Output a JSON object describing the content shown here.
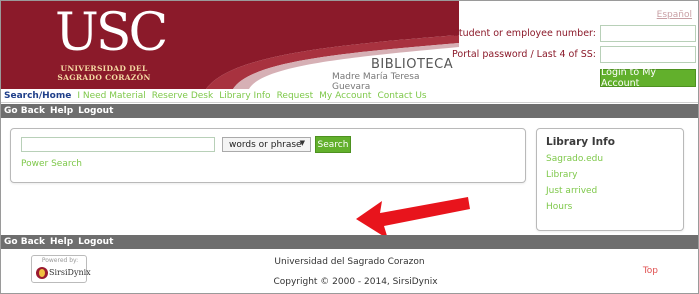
{
  "colors": {
    "brand": "#8b1a2a",
    "accent_green": "#62b02c",
    "link_green": "#7ec84a",
    "bar_grey": "#6e6e6e",
    "arrow_red": "#e8141c"
  },
  "header": {
    "logo": {
      "letters": "USC",
      "line1": "UNIVERSIDAD DEL",
      "line2": "SAGRADO CORAZÓN"
    },
    "library_title": "BIBLIOTECA",
    "library_subtitle": "Madre María Teresa Guevara"
  },
  "login": {
    "language_link": "Español",
    "user_label": "Student or employee number:",
    "user_value": "",
    "password_label": "Portal password / Last 4 of SS:",
    "password_value": "",
    "login_button": "Login to My Account"
  },
  "nav": {
    "items": [
      {
        "label": "Search/Home",
        "active": true
      },
      {
        "label": "I Need Material",
        "active": false
      },
      {
        "label": "Reserve Desk",
        "active": false
      },
      {
        "label": "Library Info",
        "active": false
      },
      {
        "label": "Request",
        "active": false
      },
      {
        "label": "My Account",
        "active": false
      },
      {
        "label": "Contact Us",
        "active": false
      }
    ]
  },
  "action_bar": {
    "go_back": "Go Back",
    "help": "Help",
    "logout": "Logout"
  },
  "search": {
    "query_value": "",
    "type_selected": "words or phrase",
    "search_button": "Search",
    "power_search_link": "Power Search"
  },
  "library_info": {
    "title": "Library Info",
    "links": [
      "Sagrado.edu",
      "Library",
      "Just arrived",
      "Hours"
    ]
  },
  "footer": {
    "powered_by": "Powered by:",
    "vendor_logo_text": "SirsiDynix",
    "org_name": "Universidad del Sagrado Corazon",
    "copyright": "Copyright © 2000 - 2014, SirsiDynix",
    "top_link": "Top"
  }
}
